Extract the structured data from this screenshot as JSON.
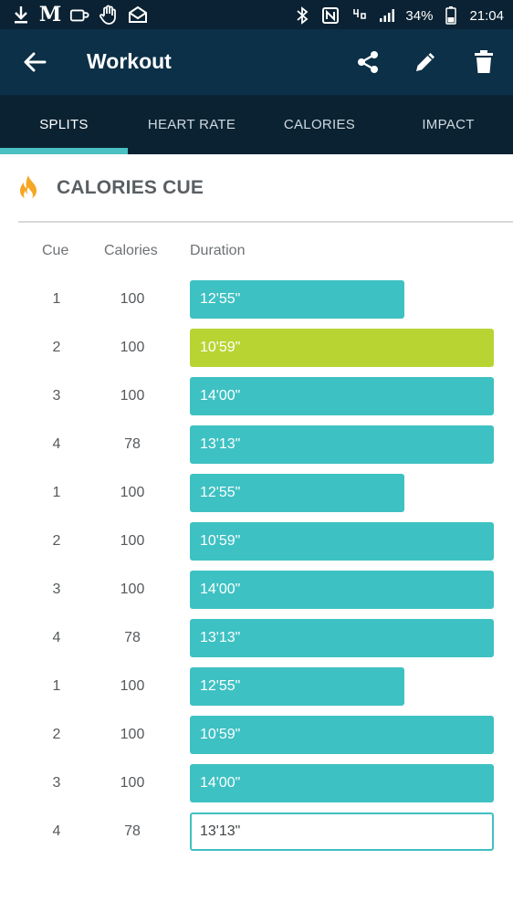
{
  "status_bar": {
    "battery": "34%",
    "time": "21:04",
    "icons": [
      "download-icon",
      "gmail-icon",
      "coffee-icon",
      "hand-icon",
      "inbox-icon",
      "bluetooth-icon",
      "nfc-icon",
      "4g-icon",
      "signal-icon",
      "battery-icon"
    ]
  },
  "app_bar": {
    "title": "Workout",
    "actions": [
      "share-icon",
      "edit-icon",
      "delete-icon"
    ]
  },
  "tabs": [
    {
      "label": "SPLITS",
      "active": true
    },
    {
      "label": "HEART RATE",
      "active": false
    },
    {
      "label": "CALORIES",
      "active": false
    },
    {
      "label": "IMPACT",
      "active": false
    }
  ],
  "section": {
    "title": "CALORIES CUE",
    "icon": "flame-icon"
  },
  "table": {
    "headers": {
      "cue": "Cue",
      "calories": "Calories",
      "duration": "Duration"
    },
    "rows": [
      {
        "cue": "1",
        "calories": "100",
        "duration": "12'55\""
      },
      {
        "cue": "2",
        "calories": "100",
        "duration": "10'59\""
      },
      {
        "cue": "3",
        "calories": "100",
        "duration": "14'00\""
      },
      {
        "cue": "4",
        "calories": "78",
        "duration": "13'13\""
      },
      {
        "cue": "1",
        "calories": "100",
        "duration": "12'55\""
      },
      {
        "cue": "2",
        "calories": "100",
        "duration": "10'59\""
      },
      {
        "cue": "3",
        "calories": "100",
        "duration": "14'00\""
      },
      {
        "cue": "4",
        "calories": "78",
        "duration": "13'13\""
      },
      {
        "cue": "1",
        "calories": "100",
        "duration": "12'55\""
      },
      {
        "cue": "2",
        "calories": "100",
        "duration": "10'59\""
      },
      {
        "cue": "3",
        "calories": "100",
        "duration": "14'00\""
      },
      {
        "cue": "4",
        "calories": "78",
        "duration": "13'13\""
      }
    ]
  },
  "colors": {
    "app_bar": "#0b3047",
    "tab_bar": "#0b2232",
    "bar_default": "#3ec1c3",
    "bar_highlight": "#b8d432",
    "flame": "#f5a623"
  }
}
